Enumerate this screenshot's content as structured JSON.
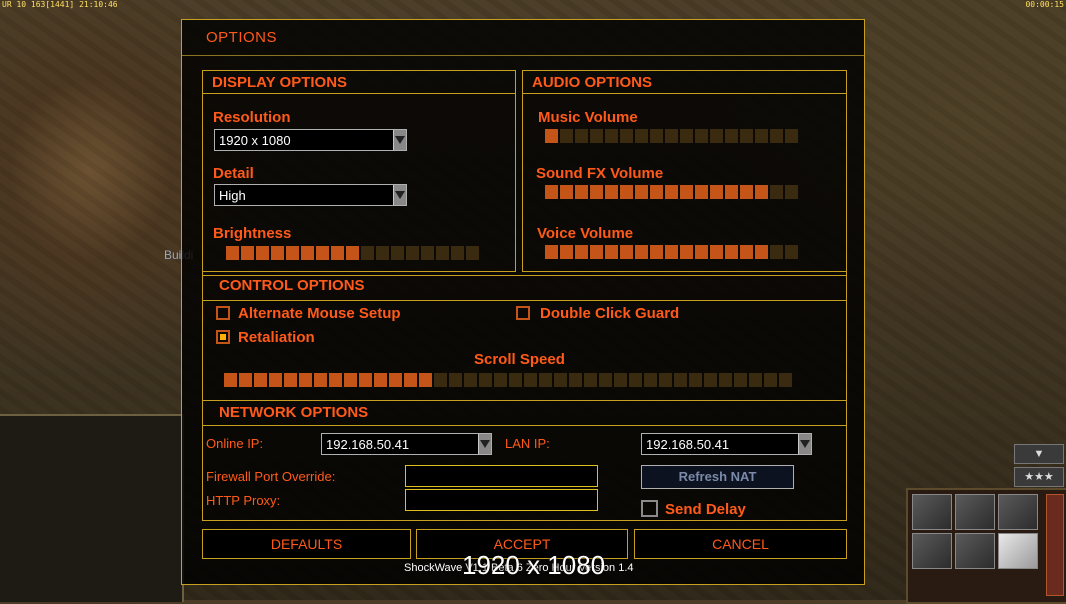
{
  "status_bar": {
    "left": "UR 10 163[1441] 21:10:46",
    "right": "00:00:15"
  },
  "background_text": "Buildi",
  "dialog": {
    "title": "OPTIONS",
    "display": {
      "header": "DISPLAY OPTIONS",
      "resolution_label": "Resolution",
      "resolution_value": "1920 x 1080",
      "detail_label": "Detail",
      "detail_value": "High",
      "brightness_label": "Brightness",
      "brightness_level": 9,
      "brightness_max": 17
    },
    "audio": {
      "header": "AUDIO OPTIONS",
      "music_label": "Music Volume",
      "music_level": 1,
      "music_max": 17,
      "sfx_label": "Sound FX Volume",
      "sfx_level": 15,
      "sfx_max": 17,
      "voice_label": "Voice Volume",
      "voice_level": 15,
      "voice_max": 17
    },
    "control": {
      "header": "CONTROL OPTIONS",
      "alt_mouse_label": "Alternate Mouse Setup",
      "alt_mouse_checked": false,
      "double_click_label": "Double Click Guard",
      "double_click_checked": false,
      "retaliation_label": "Retaliation",
      "retaliation_checked": true,
      "scroll_label": "Scroll Speed",
      "scroll_level": 14,
      "scroll_max": 38
    },
    "network": {
      "header": "NETWORK OPTIONS",
      "online_ip_label": "Online IP:",
      "online_ip_value": "192.168.50.41",
      "lan_ip_label": "LAN IP:",
      "lan_ip_value": "192.168.50.41",
      "firewall_label": "Firewall Port Override:",
      "firewall_value": "",
      "proxy_label": "HTTP Proxy:",
      "proxy_value": "",
      "refresh_label": "Refresh NAT",
      "send_delay_label": "Send Delay",
      "send_delay_checked": false
    },
    "buttons": {
      "defaults": "DEFAULTS",
      "accept": "ACCEPT",
      "cancel": "CANCEL"
    }
  },
  "overlay_resolution": "1920 x 1080",
  "footer": "ShockWave V1.1 Beta 6 Zero Hour Version 1.4",
  "colors": {
    "accent": "#ff5a1a",
    "border": "#c8a020",
    "slider_on": "#c45418",
    "slider_off": "#3a2a10"
  }
}
